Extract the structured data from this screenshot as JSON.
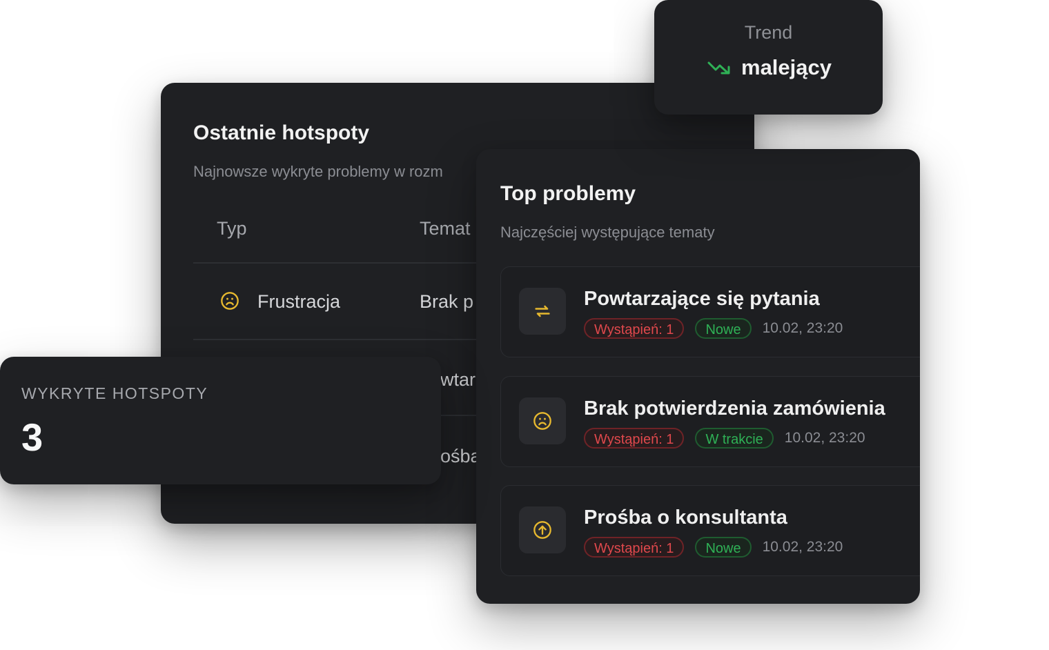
{
  "hotspots_card": {
    "title": "Ostatnie hotspoty",
    "subtitle": "Najnowsze wykryte problemy w rozm",
    "columns": [
      "Typ",
      "Temat"
    ],
    "rows": [
      {
        "type": "Frustracja",
        "topic": "Brak p",
        "icon": "frown-icon"
      },
      {
        "type": "",
        "topic": "wtar",
        "icon": ""
      },
      {
        "type": "",
        "topic": "ośba",
        "icon": ""
      }
    ]
  },
  "top_problems": {
    "title": "Top problemy",
    "subtitle": "Najczęściej występujące tematy",
    "items": [
      {
        "title": "Powtarzające się pytania",
        "occurrences": "Wystąpień: 1",
        "status": "Nowe",
        "date": "10.02, 23:20",
        "icon": "repeat-icon"
      },
      {
        "title": "Brak potwierdzenia zamówienia",
        "occurrences": "Wystąpień: 1",
        "status": "W trakcie",
        "date": "10.02, 23:20",
        "icon": "frown-icon"
      },
      {
        "title": "Prośba o konsultanta",
        "occurrences": "Wystąpień: 1",
        "status": "Nowe",
        "date": "10.02, 23:20",
        "icon": "arrow-up-circle-icon"
      }
    ]
  },
  "trend": {
    "label": "Trend",
    "value": "malejący",
    "icon": "trending-down-icon"
  },
  "detected": {
    "label": "WYKRYTE HOTSPOTY",
    "value": "3"
  },
  "colors": {
    "card_bg": "#1f2023",
    "accent_yellow": "#e7b92f",
    "danger": "#e0484c",
    "success": "#2fb156"
  }
}
